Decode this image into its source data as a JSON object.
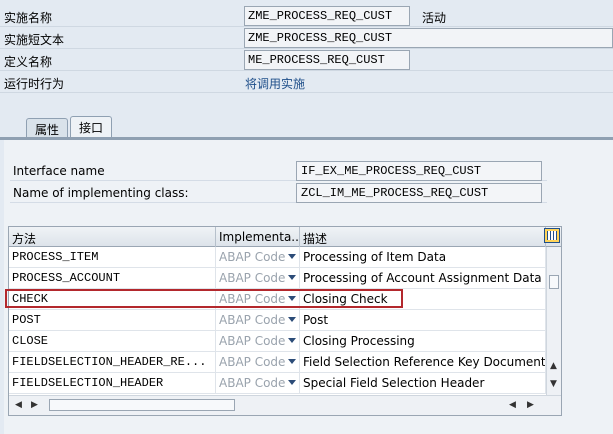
{
  "header": {
    "impl_name_label": "实施名称",
    "impl_name_value": "ZME_PROCESS_REQ_CUST",
    "impl_status": "活动",
    "impl_short_text_label": "实施短文本",
    "impl_short_text_value": "ZME_PROCESS_REQ_CUST",
    "definition_name_label": "定义名称",
    "definition_name_value": "ME_PROCESS_REQ_CUST",
    "runtime_behavior_label": "运行时行为",
    "runtime_behavior_value": "将调用实施"
  },
  "tabs": [
    {
      "label": "属性",
      "active": false
    },
    {
      "label": "接口",
      "active": true
    }
  ],
  "interface": {
    "interface_name_label": "Interface name",
    "interface_name_value": "IF_EX_ME_PROCESS_REQ_CUST",
    "impl_class_label": "Name of implementing class:",
    "impl_class_value": "ZCL_IM_ME_PROCESS_REQ_CUST"
  },
  "table": {
    "columns": [
      "方法",
      "Implementa...",
      "描述"
    ],
    "rows": [
      {
        "method": "PROCESS_ITEM",
        "impl": "ABAP Code",
        "desc": "Processing of Item Data"
      },
      {
        "method": "PROCESS_ACCOUNT",
        "impl": "ABAP Code",
        "desc": "Processing of Account Assignment Data"
      },
      {
        "method": "CHECK",
        "impl": "ABAP Code",
        "desc": "Closing Check"
      },
      {
        "method": "POST",
        "impl": "ABAP Code",
        "desc": "Post"
      },
      {
        "method": "CLOSE",
        "impl": "ABAP Code",
        "desc": "Closing Processing"
      },
      {
        "method": "FIELDSELECTION_HEADER_RE...",
        "impl": "ABAP Code",
        "desc": "Field Selection Reference Key Document He"
      },
      {
        "method": "FIELDSELECTION_HEADER",
        "impl": "ABAP Code",
        "desc": "Special Field Selection Header"
      }
    ],
    "highlighted_row": "CHECK"
  },
  "colors": {
    "highlight": "#b3282d",
    "link": "#1f4f8a",
    "background": "#e3eaf2"
  },
  "icons": {
    "table_config": "table-settings-icon"
  }
}
